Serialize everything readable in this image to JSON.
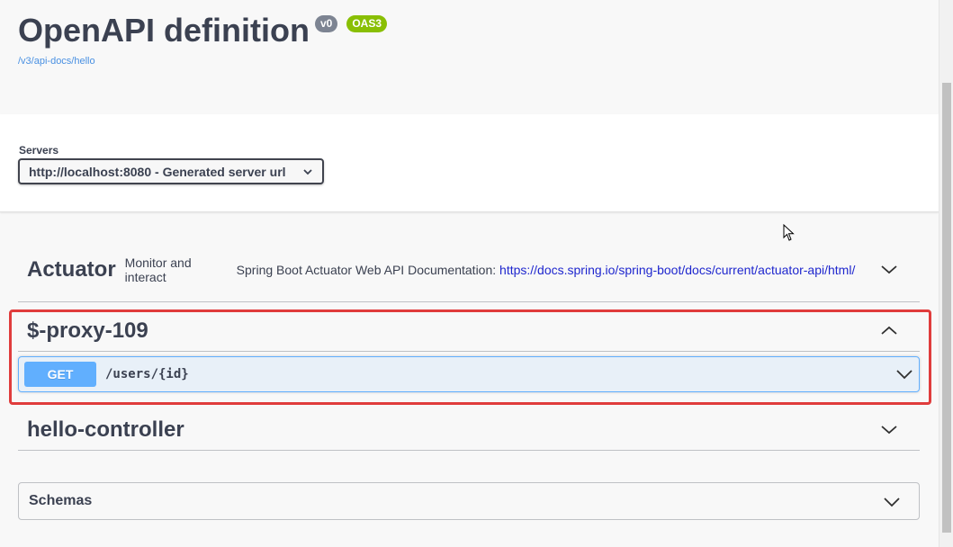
{
  "info": {
    "title": "OpenAPI definition",
    "version_badge": "v0",
    "oas_badge": "OAS3",
    "docs_link": "/v3/api-docs/hello"
  },
  "servers": {
    "label": "Servers",
    "selected": "http://localhost:8080 - Generated server url"
  },
  "tags": [
    {
      "name": "Actuator",
      "description": "Monitor and interact",
      "external_text": "Spring Boot Actuator Web API Documentation:",
      "external_url": "https://docs.spring.io/spring-boot/docs/current/actuator-api/html/",
      "expanded": false
    },
    {
      "name": "$-proxy-109",
      "expanded": true,
      "operations": [
        {
          "method": "GET",
          "path": "/users/{id}"
        }
      ]
    },
    {
      "name": "hello-controller",
      "expanded": false
    }
  ],
  "schemas": {
    "title": "Schemas"
  },
  "colors": {
    "get_method": "#61affe",
    "highlight": "#e03c3c",
    "oas_badge": "#89bf04",
    "version_badge": "#7d8492",
    "link": "#4990e2"
  },
  "icons": {
    "collapsed": "chevron-down-icon",
    "expanded": "chevron-up-icon",
    "cursor": "mouse-pointer-icon"
  }
}
